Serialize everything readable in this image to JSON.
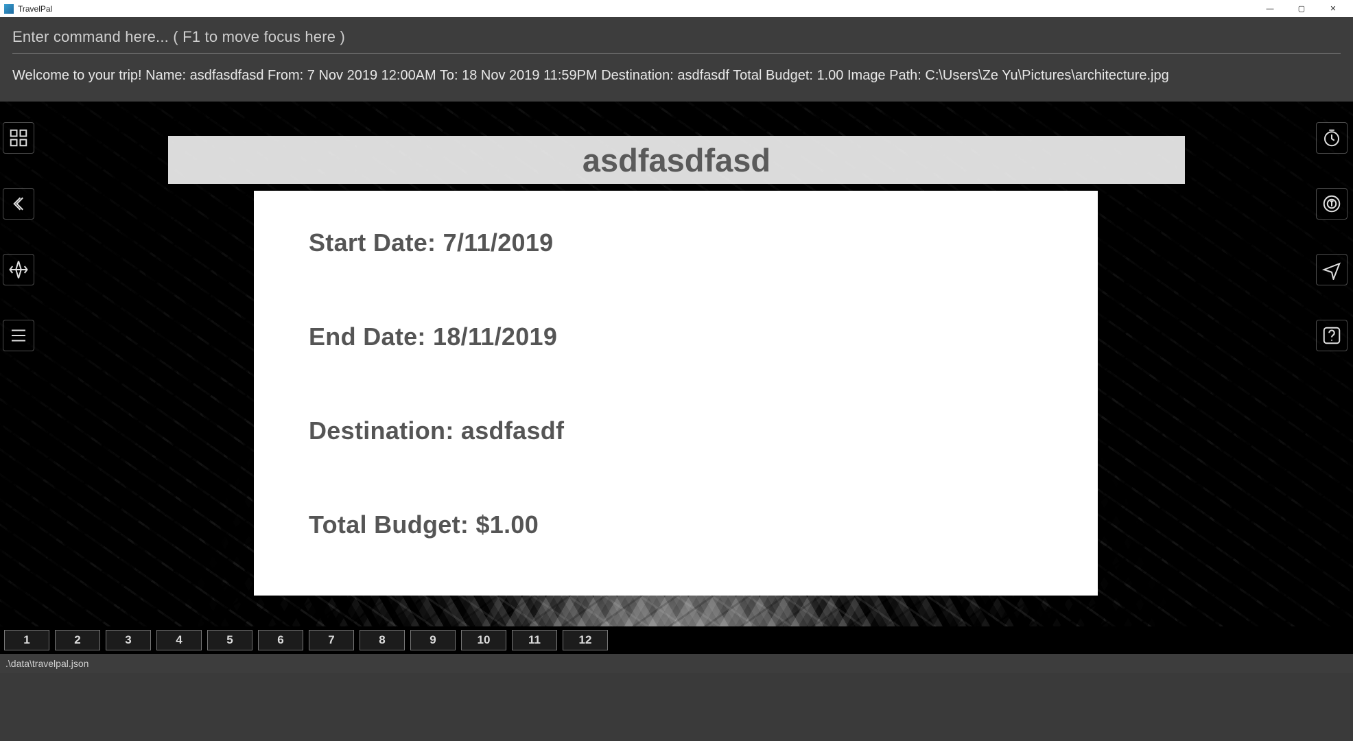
{
  "window": {
    "title": "TravelPal",
    "controls": {
      "minimize": "—",
      "maximize": "▢",
      "close": "✕"
    }
  },
  "command": {
    "placeholder": "Enter command here... ( F1 to move focus here )"
  },
  "welcome_line": "Welcome to your trip! Name: asdfasdfasd From: 7 Nov 2019 12:00AM To: 18 Nov 2019 11:59PM Destination: asdfasdf Total Budget: 1.00 Image Path: C:\\Users\\Ze Yu\\Pictures\\architecture.jpg",
  "trip": {
    "name": "asdfasdfasd",
    "start_date_line": "Start Date: 7/11/2019",
    "end_date_line": "End Date: 18/11/2019",
    "destination_line": "Destination: asdfasdf",
    "budget_line": "Total Budget: $1.00"
  },
  "tools_left": [
    "grid-icon",
    "back-icon",
    "plane-icon",
    "list-icon"
  ],
  "tools_right": [
    "clock-icon",
    "coin-icon",
    "flight-icon",
    "help-icon"
  ],
  "days": [
    "1",
    "2",
    "3",
    "4",
    "5",
    "6",
    "7",
    "8",
    "9",
    "10",
    "11",
    "12"
  ],
  "footer_path": ".\\data\\travelpal.json"
}
